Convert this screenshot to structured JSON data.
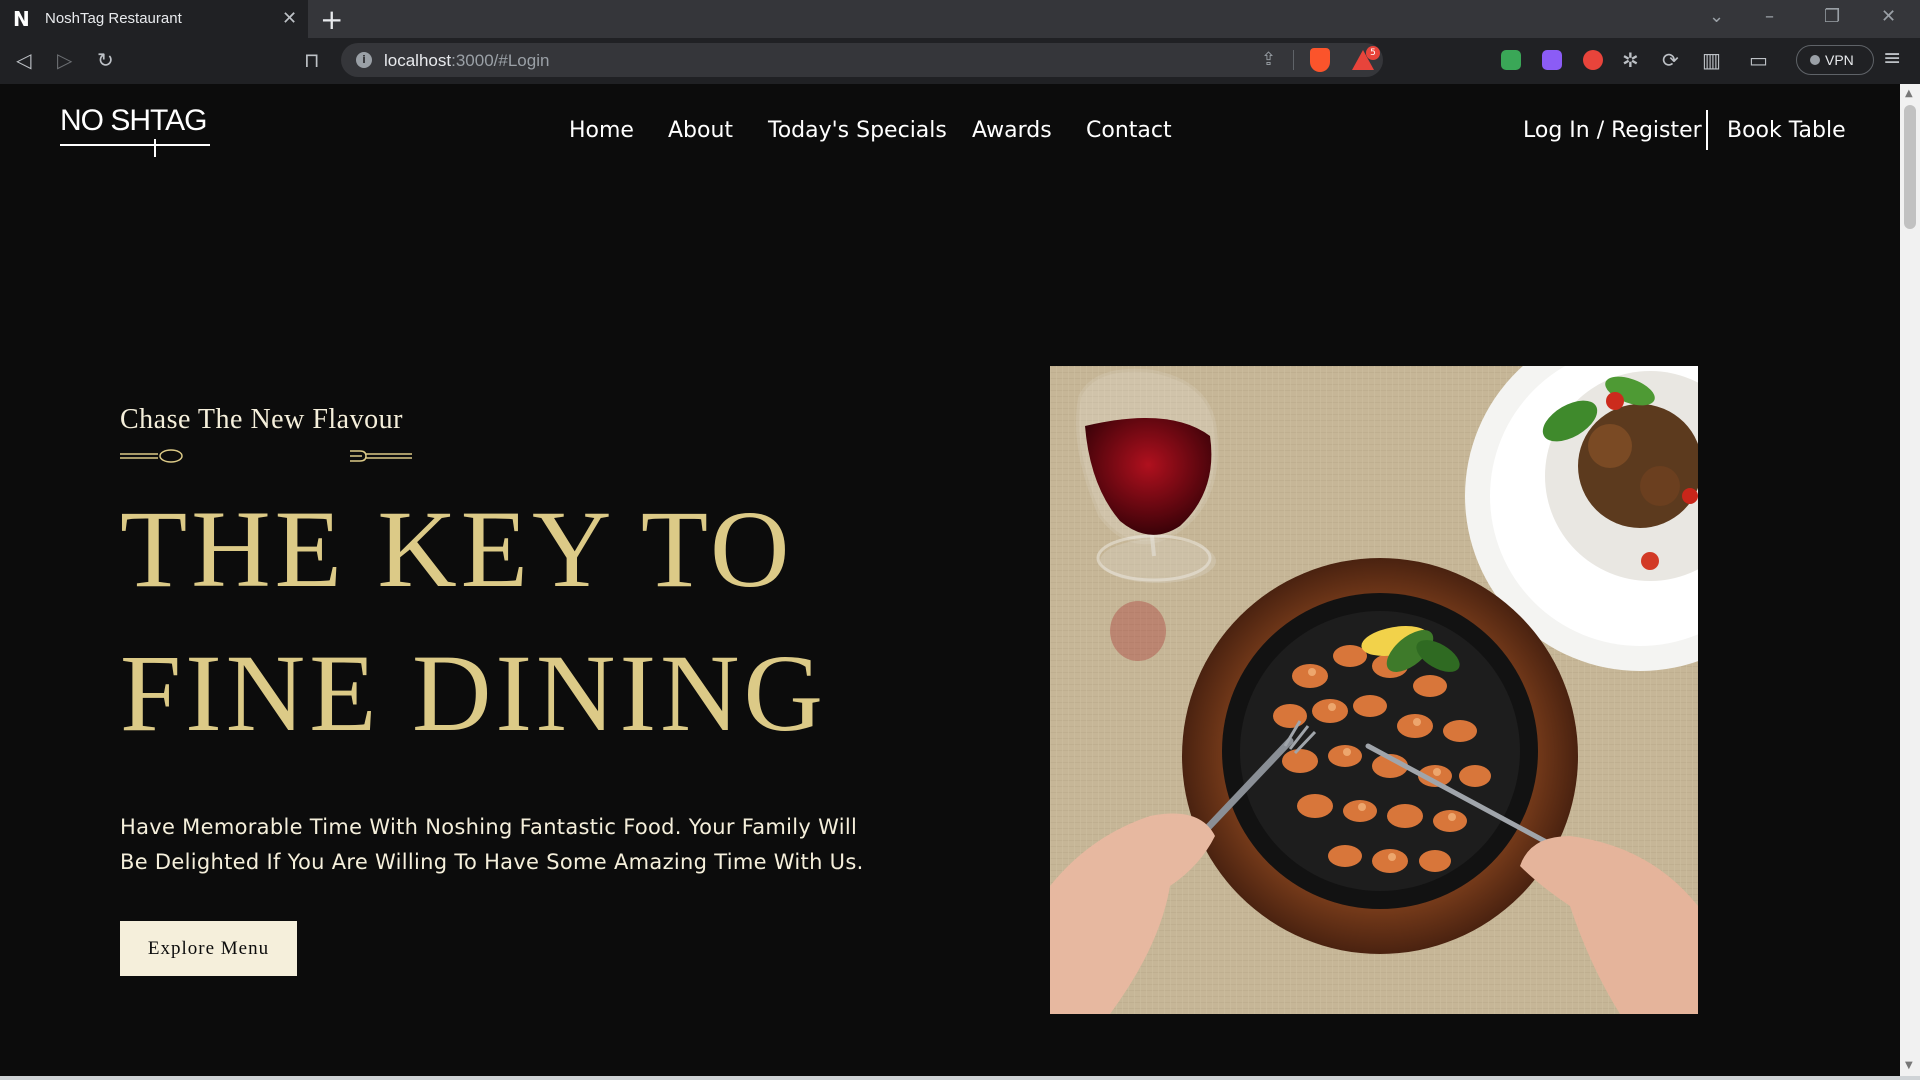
{
  "browser": {
    "tab_title": "NoshTag Restaurant",
    "favicon": "N",
    "url_host": "localhost",
    "url_rest": ":3000/#Login",
    "shield_count": "5",
    "vpn_label": "VPN"
  },
  "site": {
    "logo_text": "NO SHTAG",
    "nav": [
      "Home",
      "About",
      "Today's Specials",
      "Awards",
      "Contact"
    ],
    "login_label": "Log In / Register",
    "book_label": "Book Table"
  },
  "hero": {
    "subtitle": "Chase The New Flavour",
    "headline_line1": "THE KEY TO",
    "headline_line2": "FINE DINING",
    "description": "Have Memorable Time With Noshing Fantastic Food. Your Family Will Be Delighted If You Are Willing To Have Some Amazing Time With Us.",
    "button_label": "Explore Menu"
  },
  "colors": {
    "background": "#0c0c0c",
    "gold": "#dcca87",
    "cream": "#f5efdb"
  },
  "icons": [
    "back-icon",
    "forward-icon",
    "reload-icon",
    "bookmark-icon",
    "share-icon",
    "brave-shield-icon",
    "brave-rewards-icon",
    "extensions-icon",
    "sidebar-icon",
    "wallet-icon",
    "menu-icon"
  ]
}
